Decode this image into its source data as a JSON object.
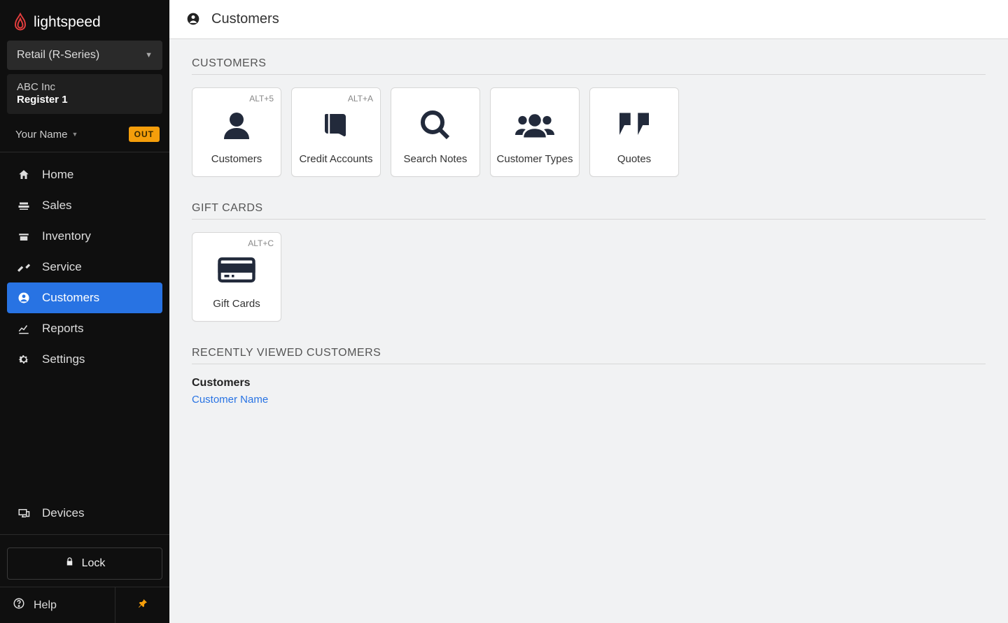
{
  "brand": {
    "name": "lightspeed"
  },
  "sidebar": {
    "product_name": "Retail (R-Series)",
    "company": "ABC Inc",
    "register": "Register 1",
    "user_name": "Your Name",
    "out_badge": "OUT",
    "nav": [
      {
        "label": "Home"
      },
      {
        "label": "Sales"
      },
      {
        "label": "Inventory"
      },
      {
        "label": "Service"
      },
      {
        "label": "Customers"
      },
      {
        "label": "Reports"
      },
      {
        "label": "Settings"
      }
    ],
    "devices_label": "Devices",
    "lock_label": "Lock",
    "help_label": "Help"
  },
  "page": {
    "title": "Customers"
  },
  "sections": {
    "customers_heading": "CUSTOMERS",
    "giftcards_heading": "GIFT CARDS",
    "recent_heading": "RECENTLY VIEWED CUSTOMERS"
  },
  "tiles": {
    "customers": {
      "label": "Customers",
      "shortcut": "ALT+5"
    },
    "credit_accounts": {
      "label": "Credit Accounts",
      "shortcut": "ALT+A"
    },
    "search_notes": {
      "label": "Search Notes"
    },
    "customer_types": {
      "label": "Customer Types"
    },
    "quotes": {
      "label": "Quotes"
    },
    "gift_cards": {
      "label": "Gift Cards",
      "shortcut": "ALT+C"
    }
  },
  "recent": {
    "group_label": "Customers",
    "items": [
      {
        "name": "Customer Name"
      }
    ]
  }
}
